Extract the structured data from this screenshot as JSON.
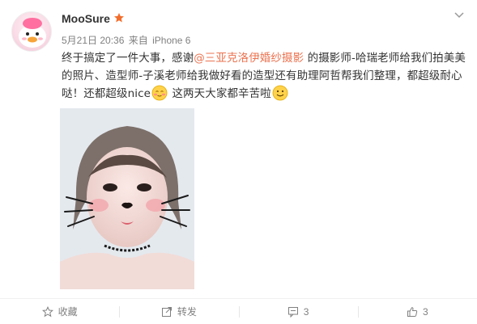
{
  "post": {
    "username": "MooSure",
    "badge_icon": "vip-star-icon",
    "date": "5月21日 20:36",
    "via_prefix": "来自",
    "device": "iPhone 6",
    "text_part1": "终于搞定了一件大事，感谢",
    "mention": "@三亚克洛伊婚纱摄影",
    "text_part2": " 的摄影师-哈瑞老师给我们拍美美的照片、造型师-子溪老师给我做好看的造型还有助理阿哲帮我们整理，都超级耐心哒！还都超级nice",
    "emoji_1": "blush-emoji-icon",
    "text_part3": " 这两天大家都辛苦啦",
    "emoji_2": "smile-emoji-icon",
    "image_icon": "photo-thumbnail"
  },
  "actions": {
    "favorite_label": "收藏",
    "repost_label": "转发",
    "comment_count": "3",
    "like_count": "3"
  },
  "colors": {
    "mention": "#eb7350",
    "text": "#333333",
    "meta": "#808080",
    "badge": "#f26d2c"
  }
}
